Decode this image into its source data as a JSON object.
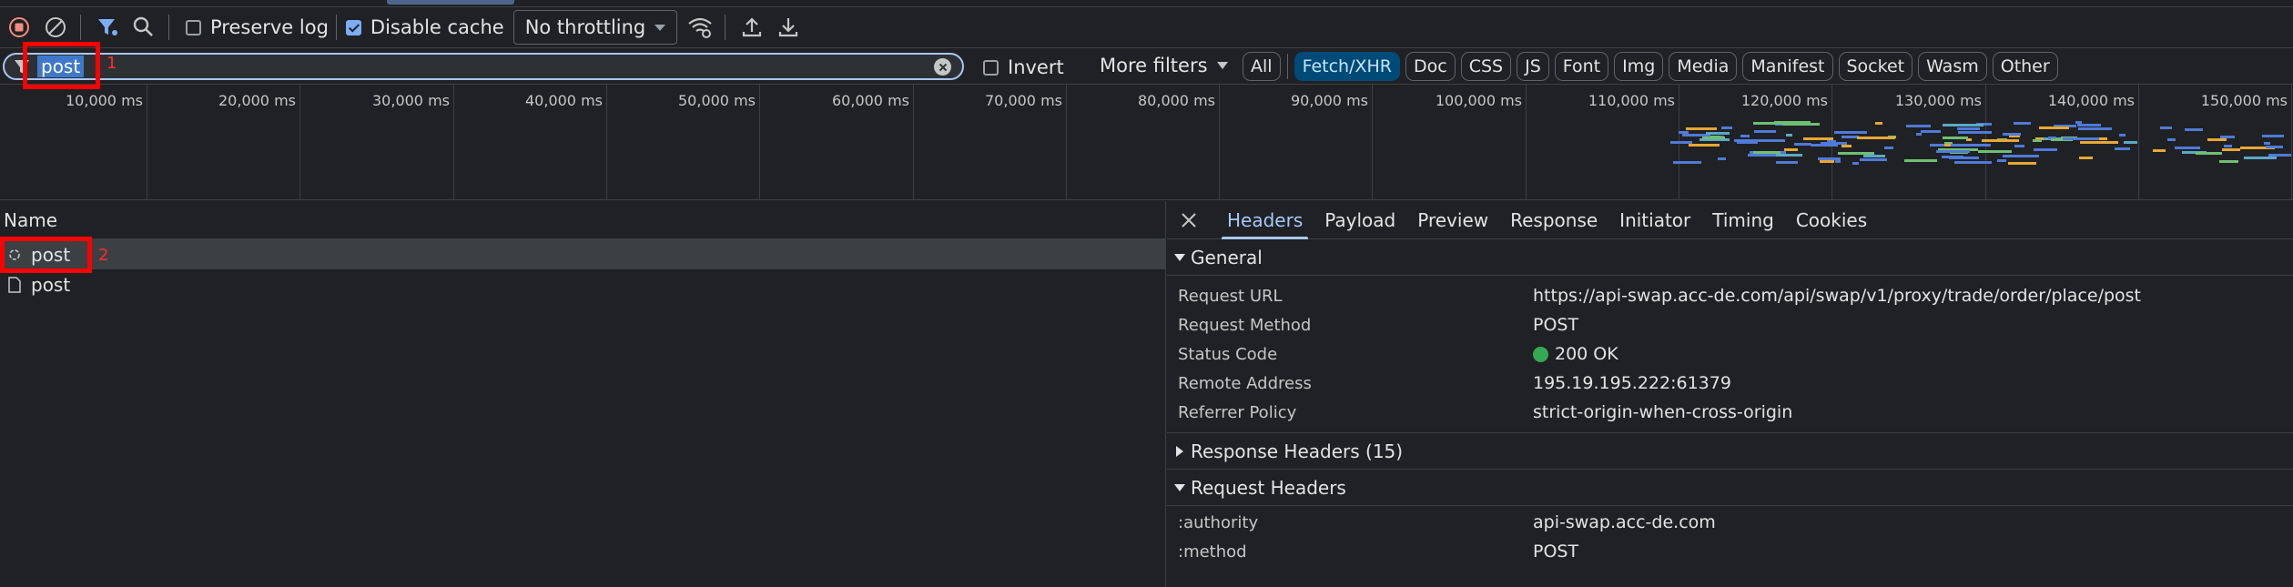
{
  "toolbar": {
    "preserve_log_label": "Preserve log",
    "disable_cache_label": "Disable cache",
    "throttling_value": "No throttling"
  },
  "filter": {
    "search_value": "post",
    "invert_label": "Invert",
    "more_filters_label": "More filters",
    "chips": [
      "All",
      "Fetch/XHR",
      "Doc",
      "CSS",
      "JS",
      "Font",
      "Img",
      "Media",
      "Manifest",
      "Socket",
      "Wasm",
      "Other"
    ],
    "active_chip": "Fetch/XHR"
  },
  "annotations": {
    "marker_1": "1",
    "marker_2": "2"
  },
  "timeline": {
    "ticks": [
      "10,000 ms",
      "20,000 ms",
      "30,000 ms",
      "40,000 ms",
      "50,000 ms",
      "60,000 ms",
      "70,000 ms",
      "80,000 ms",
      "90,000 ms",
      "100,000 ms",
      "110,000 ms",
      "120,000 ms",
      "130,000 ms",
      "140,000 ms",
      "150,000 ms"
    ]
  },
  "requests": {
    "column_name": "Name",
    "rows": [
      {
        "name": "post",
        "icon": "xhr-icon"
      },
      {
        "name": "post",
        "icon": "document-icon"
      }
    ]
  },
  "details": {
    "tabs": [
      "Headers",
      "Payload",
      "Preview",
      "Response",
      "Initiator",
      "Timing",
      "Cookies"
    ],
    "active_tab": "Headers",
    "general": {
      "title": "General",
      "request_url_key": "Request URL",
      "request_url": "https://api-swap.acc-de.com/api/swap/v1/proxy/trade/order/place/post",
      "request_method_key": "Request Method",
      "request_method": "POST",
      "status_code_key": "Status Code",
      "status_code": "200 OK",
      "remote_address_key": "Remote Address",
      "remote_address": "195.19.195.222:61379",
      "referrer_policy_key": "Referrer Policy",
      "referrer_policy": "strict-origin-when-cross-origin"
    },
    "response_headers_title": "Response Headers (15)",
    "request_headers": {
      "title": "Request Headers",
      "authority_key": ":authority",
      "authority": "api-swap.acc-de.com",
      "method_key": ":method",
      "method": "POST"
    }
  },
  "colors": {
    "accent": "#a8c7fa",
    "active_chip_bg": "#004a77",
    "status_ok": "#34a853",
    "annotation": "#ff0000"
  }
}
